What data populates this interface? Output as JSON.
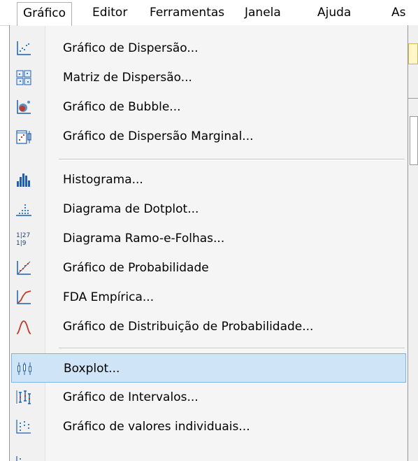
{
  "menubar": {
    "items": [
      {
        "label": "Gráfico",
        "open": true
      },
      {
        "label": "Editor"
      },
      {
        "label": "Ferramentas"
      },
      {
        "label": "Janela"
      },
      {
        "label": "Ajuda"
      },
      {
        "label": "As"
      }
    ]
  },
  "menu": {
    "items": [
      {
        "label": "Gráfico de Dispersão...",
        "icon": "scatterplot-icon"
      },
      {
        "label": "Matriz de Dispersão...",
        "icon": "matrix-plot-icon"
      },
      {
        "label": "Gráfico de Bubble...",
        "icon": "bubble-plot-icon"
      },
      {
        "label": "Gráfico de Dispersão Marginal...",
        "icon": "marginal-plot-icon"
      },
      {
        "label": "Histograma...",
        "icon": "histogram-icon"
      },
      {
        "label": "Diagrama de Dotplot...",
        "icon": "dotplot-icon"
      },
      {
        "label": "Diagrama Ramo-e-Folhas...",
        "icon": "stem-and-leaf-icon"
      },
      {
        "label": "Gráfico de Probabilidade",
        "icon": "probability-plot-icon"
      },
      {
        "label": "FDA Empírica...",
        "icon": "empirical-cdf-icon"
      },
      {
        "label": "Gráfico de Distribuição de Probabilidade...",
        "icon": "distribution-curve-icon"
      },
      {
        "label": "Boxplot...",
        "icon": "boxplot-icon",
        "highlighted": true
      },
      {
        "label": "Gráfico de Intervalos...",
        "icon": "interval-plot-icon"
      },
      {
        "label": "Gráfico de valores individuais...",
        "icon": "individual-value-plot-icon"
      }
    ],
    "stem_icon_text": {
      "top": "1|27",
      "bottom": "1|9"
    }
  },
  "colors": {
    "highlight_bg": "#cfe4f7",
    "highlight_border": "#7fb3e2",
    "icon_blue": "#1f5fae",
    "icon_red": "#c0392b"
  }
}
